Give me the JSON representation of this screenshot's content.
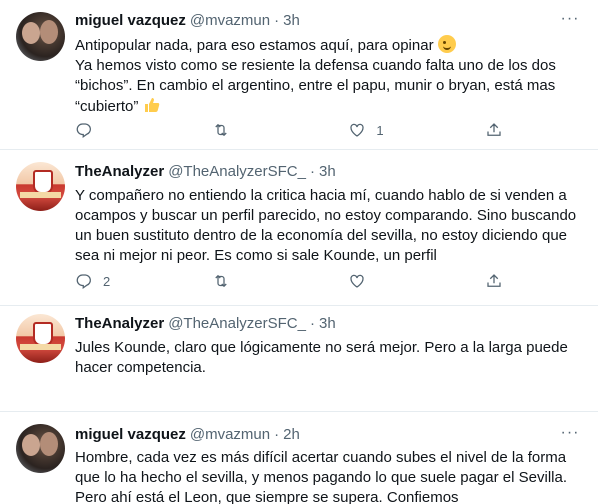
{
  "tweets": [
    {
      "name": "miguel vazquez",
      "handle": "@mvazmun",
      "separator": "·",
      "time": "3h",
      "avatar": "person-avatar",
      "text": "Antipopular nada, para eso estamos aquí, para opinar",
      "text2": "Ya hemos visto como se resiente la defensa cuando falta uno de los dos “bichos”. En cambio el argentino, entre el papu, munir o bryan, está mas “cubierto”",
      "emoji1": "wink-emoji",
      "emoji2": "thumbs-up-emoji",
      "reply_count": "",
      "retweet_count": "",
      "like_count": "1"
    },
    {
      "name": "TheAnalyzer",
      "handle": "@TheAnalyzerSFC_",
      "separator": "·",
      "time": "3h",
      "avatar": "club-avatar",
      "text": "Y compañero no entiendo la critica hacia mí, cuando hablo de si venden a ocampos y buscar un perfil parecido, no estoy comparando. Sino buscando un buen sustituto dentro de la economía del sevilla, no estoy diciendo que sea ni mejor ni peor. Es como si sale Kounde, un perfil",
      "reply_count": "2",
      "retweet_count": "",
      "like_count": ""
    },
    {
      "name": "TheAnalyzer",
      "handle": "@TheAnalyzerSFC_",
      "separator": "·",
      "time": "3h",
      "avatar": "club-avatar",
      "text": "Jules Kounde, claro que lógicamente no será mejor. Pero a la larga puede hacer competencia."
    },
    {
      "name": "miguel vazquez",
      "handle": "@mvazmun",
      "separator": "·",
      "time": "2h",
      "avatar": "person-avatar",
      "text": "Hombre, cada vez es más difícil acertar cuando subes el nivel de la forma que lo ha hecho el sevilla, y menos pagando lo que suele pagar el Sevilla. Pero ahí está el Leon, que siempre se supera. Confiemos"
    }
  ],
  "icons": {
    "reply": "reply-icon",
    "retweet": "retweet-icon",
    "like": "heart-icon",
    "share": "share-icon",
    "more": "more-icon"
  }
}
